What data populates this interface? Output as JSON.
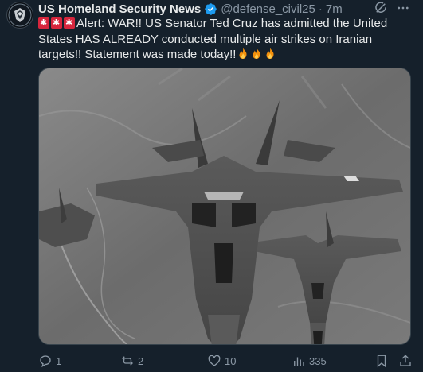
{
  "author": {
    "name": "US Homeland Security News",
    "handle": "@defense_civil25",
    "separator": "·",
    "time": "7m",
    "verified": true
  },
  "tweet": {
    "text": "Alert: WAR!! US Senator Ted Cruz has admitted the United States HAS ALREADY conducted multiple air strikes on Iranian targets!! Statement was made today!!",
    "leading_emojis": [
      "siren",
      "siren",
      "siren"
    ],
    "trailing_emojis": [
      "fire",
      "fire",
      "fire"
    ]
  },
  "media": {
    "icons": [
      "fighter-jet-image"
    ]
  },
  "actions": {
    "replies": "1",
    "reposts": "2",
    "likes": "10",
    "views": "335"
  },
  "colors": {
    "background": "#15202b",
    "text": "#e7e9ea",
    "secondary": "#8b98a5",
    "verified": "#1d9bf0"
  }
}
